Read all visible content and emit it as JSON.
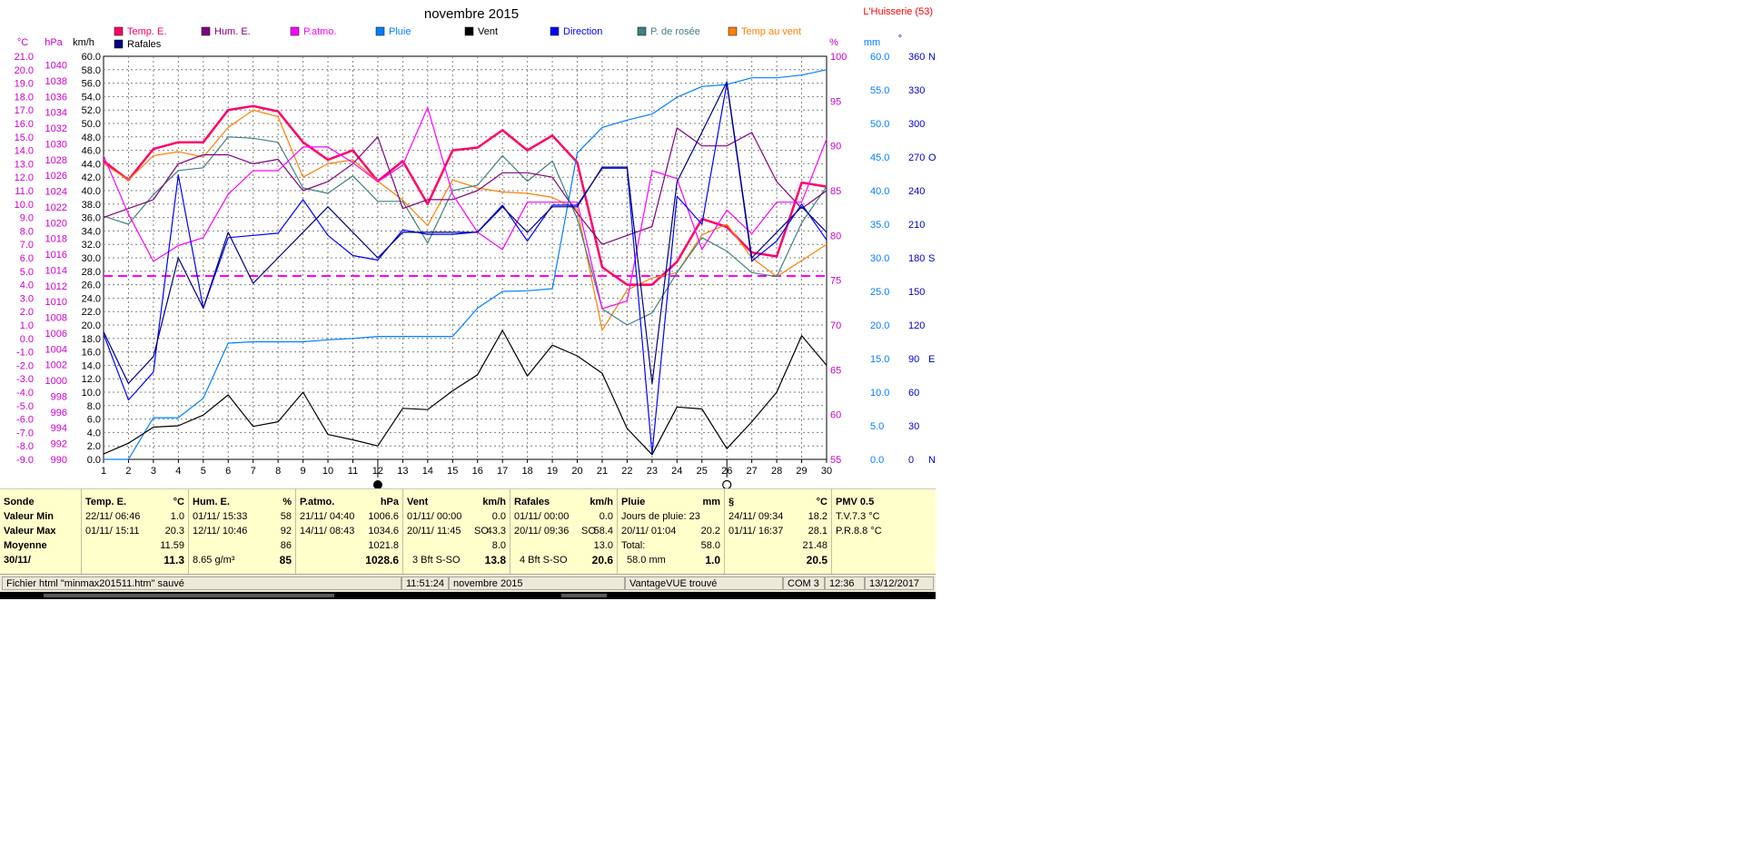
{
  "title": "novembre 2015",
  "station": "L'Huisserie (53)",
  "axes": {
    "left_temp": {
      "unit": "°C",
      "ticks": [
        "21.0",
        "20.0",
        "19.0",
        "18.0",
        "17.0",
        "16.0",
        "15.0",
        "14.0",
        "13.0",
        "12.0",
        "11.0",
        "10.0",
        "9.0",
        "8.0",
        "7.0",
        "6.0",
        "5.0",
        "4.0",
        "3.0",
        "2.0",
        "1.0",
        "0.0",
        "-1.0",
        "-2.0",
        "-3.0",
        "-4.0",
        "-5.0",
        "-6.0",
        "-7.0",
        "-8.0",
        "-9.0"
      ]
    },
    "left_press": {
      "unit": "hPa",
      "ticks": [
        "1040",
        "1038",
        "1036",
        "1034",
        "1032",
        "1030",
        "1028",
        "1026",
        "1024",
        "1022",
        "1020",
        "1018",
        "1016",
        "1014",
        "1012",
        "1010",
        "1008",
        "1006",
        "1004",
        "1002",
        "1000",
        "998",
        "996",
        "994",
        "992",
        "990"
      ]
    },
    "left_wind": {
      "unit": "km/h",
      "ticks": [
        "60.0",
        "58.0",
        "56.0",
        "54.0",
        "52.0",
        "50.0",
        "48.0",
        "46.0",
        "44.0",
        "42.0",
        "40.0",
        "38.0",
        "36.0",
        "34.0",
        "32.0",
        "30.0",
        "28.0",
        "26.0",
        "24.0",
        "22.0",
        "20.0",
        "18.0",
        "16.0",
        "14.0",
        "12.0",
        "10.0",
        "8.0",
        "6.0",
        "4.0",
        "2.0",
        "0.0"
      ]
    },
    "right_hum": {
      "unit": "%",
      "ticks": [
        "100",
        "95",
        "90",
        "85",
        "80",
        "75",
        "70",
        "65",
        "60",
        "55"
      ]
    },
    "right_rain": {
      "unit": "mm",
      "ticks": [
        "60.0",
        "55.0",
        "50.0",
        "45.0",
        "40.0",
        "35.0",
        "30.0",
        "25.0",
        "20.0",
        "15.0",
        "10.0",
        "5.0",
        "0.0"
      ]
    },
    "right_dir": {
      "unit": "°",
      "ticks": [
        [
          "360",
          "N"
        ],
        [
          "330",
          ""
        ],
        [
          "300",
          ""
        ],
        [
          "270",
          "O"
        ],
        [
          "240",
          ""
        ],
        [
          "210",
          ""
        ],
        [
          "180",
          "S"
        ],
        [
          "150",
          ""
        ],
        [
          "120",
          ""
        ],
        [
          "90",
          "E"
        ],
        [
          "60",
          ""
        ],
        [
          "30",
          ""
        ],
        [
          "0",
          "N"
        ]
      ]
    }
  },
  "legend": [
    {
      "label": "Temp. E.",
      "color": "#ff0066"
    },
    {
      "label": "Hum. E.",
      "color": "#800080"
    },
    {
      "label": "P.atmo.",
      "color": "#ff00ff"
    },
    {
      "label": "Pluie",
      "color": "#0080ff"
    },
    {
      "label": "Vent",
      "color": "#000000"
    },
    {
      "label": "Direction",
      "color": "#0000ff"
    },
    {
      "label": "P. de rosée",
      "color": "#408080"
    },
    {
      "label": "Temp au vent",
      "color": "#ff8000"
    },
    {
      "label": "Rafales",
      "color": "#000080"
    }
  ],
  "chart_data": {
    "type": "line",
    "title": "novembre 2015",
    "x": [
      1,
      2,
      3,
      4,
      5,
      6,
      7,
      8,
      9,
      10,
      11,
      12,
      13,
      14,
      15,
      16,
      17,
      18,
      19,
      20,
      21,
      22,
      23,
      24,
      25,
      26,
      27,
      28,
      29,
      30
    ],
    "grid": true,
    "legend_position": "top",
    "series": [
      {
        "name": "Temp. E.",
        "axis": "°C",
        "color": "#ff0066",
        "values": [
          13.2,
          11.8,
          14.1,
          14.6,
          14.6,
          17.0,
          17.3,
          16.9,
          14.6,
          13.3,
          14.0,
          11.7,
          13.2,
          10.0,
          14.0,
          14.2,
          15.5,
          14.0,
          15.1,
          13.1,
          5.3,
          4.0,
          4.0,
          5.7,
          8.9,
          8.3,
          6.4,
          6.1,
          11.6,
          11.3
        ]
      },
      {
        "name": "Temp au vent",
        "axis": "°C",
        "color": "#ff8000",
        "values": [
          13.0,
          11.8,
          13.6,
          13.9,
          13.5,
          15.7,
          17.0,
          16.5,
          12.0,
          13.0,
          13.3,
          11.7,
          10.3,
          8.4,
          11.8,
          11.2,
          10.9,
          10.8,
          10.5,
          9.6,
          0.6,
          3.6,
          4.5,
          4.9,
          7.7,
          8.5,
          6.0,
          4.6,
          5.8,
          7.0
        ]
      },
      {
        "name": "P. de rosée",
        "axis": "°C",
        "color": "#408080",
        "values": [
          9.1,
          8.5,
          10.7,
          12.5,
          12.7,
          15.0,
          14.9,
          14.6,
          11.2,
          10.8,
          12.1,
          10.2,
          10.2,
          7.1,
          11.0,
          11.4,
          13.6,
          11.7,
          13.2,
          8.9,
          2.2,
          1.0,
          1.9,
          4.9,
          7.5,
          6.5,
          4.9,
          4.6,
          8.6,
          11.3
        ]
      },
      {
        "name": "Hum. E.",
        "axis": "%",
        "color": "#800080",
        "values": [
          82,
          83,
          84,
          88,
          89,
          89,
          88,
          88.5,
          85,
          86,
          88,
          91,
          83,
          84,
          84,
          85,
          87,
          87,
          86.5,
          82.5,
          79,
          80,
          81,
          92,
          90,
          90,
          91.5,
          86,
          83,
          85
        ]
      },
      {
        "name": "P.atmo.",
        "axis": "hPa",
        "color": "#ff00ff",
        "values": [
          1028.5,
          1021.1,
          1015.1,
          1017.1,
          1018.1,
          1023.6,
          1026.6,
          1026.6,
          1029.6,
          1029.6,
          1027.6,
          1025.2,
          1027.3,
          1034.6,
          1023.6,
          1018.8,
          1016.6,
          1022.6,
          1022.6,
          1022.6,
          1009.1,
          1010.1,
          1026.6,
          1025.6,
          1016.6,
          1021.6,
          1018.6,
          1022.6,
          1022.6,
          1030.6
        ]
      },
      {
        "name": "Pluie",
        "axis": "mm",
        "color": "#0080ff",
        "values": [
          0.0,
          0.0,
          6.2,
          6.2,
          9.1,
          17.3,
          17.5,
          17.5,
          17.5,
          17.8,
          18.0,
          18.3,
          18.3,
          18.3,
          18.3,
          22.5,
          25.0,
          25.1,
          25.4,
          45.6,
          49.4,
          50.5,
          51.4,
          53.9,
          55.5,
          55.8,
          56.8,
          56.8,
          57.2,
          58.0
        ]
      },
      {
        "name": "Direction",
        "axis": "°",
        "color": "#0000ff",
        "values": [
          112,
          53,
          78,
          254,
          135,
          198,
          200,
          202,
          232,
          200,
          182,
          178,
          205,
          201,
          201,
          203,
          227,
          195,
          227,
          227,
          260,
          260,
          5,
          235,
          210,
          336,
          177,
          195,
          228,
          196
        ]
      },
      {
        "name": "Rafales",
        "axis": "km/h",
        "color": "#000080",
        "values": [
          19.0,
          11.3,
          15.3,
          30.0,
          22.5,
          33.8,
          26.2,
          30.0,
          33.8,
          37.6,
          33.8,
          30.0,
          33.8,
          33.8,
          33.8,
          33.8,
          37.6,
          33.8,
          37.6,
          37.6,
          43.5,
          43.5,
          11.3,
          41.3,
          48.7,
          56.2,
          30.0,
          33.8,
          37.6,
          33.8
        ]
      },
      {
        "name": "Vent",
        "axis": "km/h",
        "color": "#000000",
        "values": [
          0.8,
          2.4,
          4.8,
          5.0,
          6.6,
          9.6,
          4.9,
          5.6,
          10.0,
          3.7,
          2.9,
          2.0,
          7.6,
          7.4,
          10.2,
          12.6,
          19.2,
          12.4,
          17.0,
          15.4,
          12.8,
          4.6,
          0.7,
          7.8,
          7.5,
          1.6,
          5.6,
          10.0,
          18.4,
          14.0
        ]
      }
    ],
    "reference_lines": [
      {
        "axis": "hPa",
        "value": 1013.25,
        "style": "dashed",
        "color": "#ff00ff"
      }
    ]
  },
  "summary": {
    "sonde": {
      "header": "Sonde",
      "min": "Valeur Min",
      "max": "Valeur Max",
      "avg": "Moyenne",
      "last": "30/11/"
    },
    "temp": {
      "header": "Temp. E.",
      "unit": "°C",
      "min_date": "22/11/  06:46",
      "min_val": "1.0",
      "max_date": "01/11/  15:11",
      "max_val": "20.3",
      "avg": "11.59",
      "last": "11.3"
    },
    "hum": {
      "header": "Hum. E.",
      "unit": "%",
      "min_date": "01/11/  15:33",
      "min_val": "58",
      "max_date": "12/11/  10:46",
      "max_val": "92",
      "avg": "86",
      "last_left": "8.65 g/m³",
      "last": "85"
    },
    "patmo": {
      "header": "P.atmo.",
      "unit": "hPa",
      "min_date": "21/11/  04:40",
      "min_val": "1006.6",
      "max_date": "14/11/  08:43",
      "max_val": "1034.6",
      "avg": "1021.8",
      "last": "1028.6"
    },
    "vent": {
      "header": "Vent",
      "unit": "km/h",
      "min_date": "01/11/  00:00",
      "min_val": "0.0",
      "max_date": "20/11/  11:45",
      "max_mid": "SO",
      "max_val": "43.3",
      "avg": "8.0",
      "last_left": "3 Bft S-SO",
      "last": "13.8"
    },
    "rafales": {
      "header": "Rafales",
      "unit": "km/h",
      "min_date": "01/11/  00:00",
      "min_val": "0.0",
      "max_date": "20/11/  09:36",
      "max_mid": "SO",
      "max_val": "58.4",
      "avg": "13.0",
      "last_left": "4 Bft S-SO",
      "last": "20.6"
    },
    "pluie": {
      "header": "Pluie",
      "unit": "mm",
      "row1": "Jours de pluie: 23",
      "max_date": "20/11/  01:04",
      "max_val": "20.2",
      "total_label": "Total:",
      "total_val": "58.0",
      "last_left": "58.0 mm",
      "last": "1.0"
    },
    "extra": {
      "header": "§",
      "unit": "°C",
      "min_date": "24/11/  09:34",
      "min_val": "18.2",
      "max_date": "01/11/  16:37",
      "max_val": "28.1",
      "avg": "21.48",
      "last": "20.5"
    },
    "pmv": {
      "header": "PMV 0.5",
      "row1": "T.V.7.3 °C",
      "row2": "P.R.8.8 °C"
    }
  },
  "status": {
    "file": "Fichier html  \"minmax201511.htm\"  sauvé",
    "time": "11:51:24",
    "month": "novembre 2015",
    "device": "VantageVUE trouvé",
    "port": "COM 3",
    "clock": "12:36",
    "date": "13/12/2017"
  },
  "moon_marks": [
    {
      "day": 12,
      "phase": "new-moon"
    },
    {
      "day": 26,
      "phase": "full-moon"
    }
  ]
}
